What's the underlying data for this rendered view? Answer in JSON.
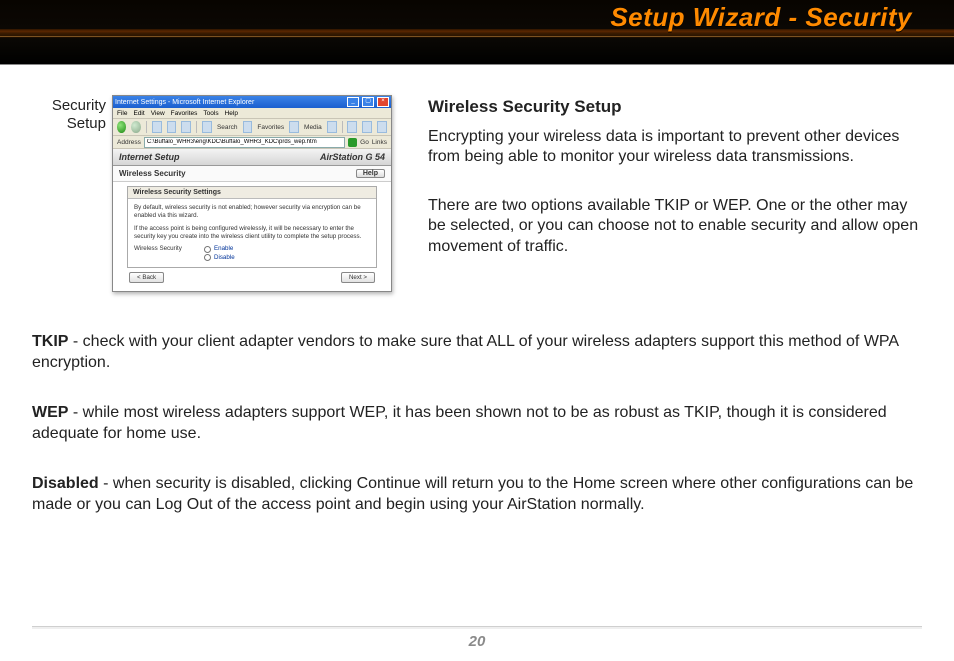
{
  "header": {
    "title": "Setup Wizard - Security"
  },
  "figure": {
    "caption_l1": "Security",
    "caption_l2": "Setup",
    "ie": {
      "title": "Internet Settings - Microsoft Internet Explorer",
      "menu": [
        "File",
        "Edit",
        "View",
        "Favorites",
        "Tools",
        "Help"
      ],
      "toolbar": {
        "search": "Search",
        "favorites": "Favorites",
        "media": "Media"
      },
      "address_label": "Address",
      "address_value": "C:\\Buffalo_WHR3\\eng\\KDC\\Buffalo_WHR3_KDC\\prds_wep.htm",
      "go_label": "Go",
      "links_label": "Links"
    },
    "app": {
      "title": "Internet Setup",
      "brand": "AirStation",
      "model": "G 54",
      "subheading": "Wireless Security",
      "help": "Help",
      "panel_title": "Wireless Security Settings",
      "note1": "By default, wireless security is not enabled; however security via encryption can be enabled via this wizard.",
      "note2": "If the access point is being configured wirelessly, it will be necessary to enter the security key you create into the wireless client utility to complete the setup process.",
      "opt_label": "Wireless Security",
      "opt_enable": "Enable",
      "opt_disable": "Disable",
      "btn_back": "< Back",
      "btn_next": "Next >"
    }
  },
  "intro": {
    "heading": "Wireless Security Setup",
    "p1": "Encrypting your wireless data is important to prevent other devices from being able to moni­tor your wireless data transmissions.",
    "p2": "There are two options available TKIP or WEP. One or the other may be selected, or you can choose not to enable security and allow open movement of traffic."
  },
  "defs": {
    "tkip": {
      "term": "TKIP",
      "text": " - check with your client adapter vendors to make sure that ALL of your wireless adapters sup­port this method of WPA encryption."
    },
    "wep": {
      "term": "WEP",
      "text": " - while most wireless adapters support WEP, it has been shown not to be as robust as TKIP, though it is considered adequate for home use."
    },
    "disabled": {
      "term": "Disabled",
      "text": " - when security is disabled, clicking Continue will return you to the Home screen where other configurations can be made or you can Log Out of the access point and begin using your AirStation normally."
    }
  },
  "footer": {
    "page": "20"
  }
}
